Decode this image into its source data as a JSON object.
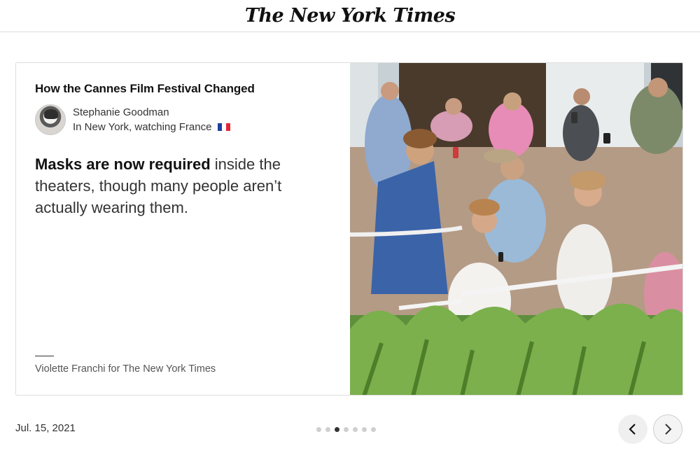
{
  "masthead": {
    "logo_text": "The New York Times"
  },
  "card": {
    "title": "How the Cannes Film Festival Changed",
    "author": {
      "name": "Stephanie Goodman",
      "location": "In New York, watching France"
    },
    "body_bold": "Masks are now required",
    "body_rest": " inside the theaters, though many people aren’t actually wearing them.",
    "photo_credit": "Violette Franchi for The New York Times",
    "photo_alt": "Crowd outside the festival holding up phones"
  },
  "footer": {
    "date": "Jul. 15, 2021",
    "slide_index": 3,
    "slide_count": 7,
    "prev_icon": "chevron-left-icon",
    "next_icon": "chevron-right-icon"
  },
  "colors": {
    "text": "#121212",
    "muted": "#555555",
    "border": "#dedede",
    "dot_active": "#333333",
    "dot_inactive": "#cfcfcf"
  }
}
